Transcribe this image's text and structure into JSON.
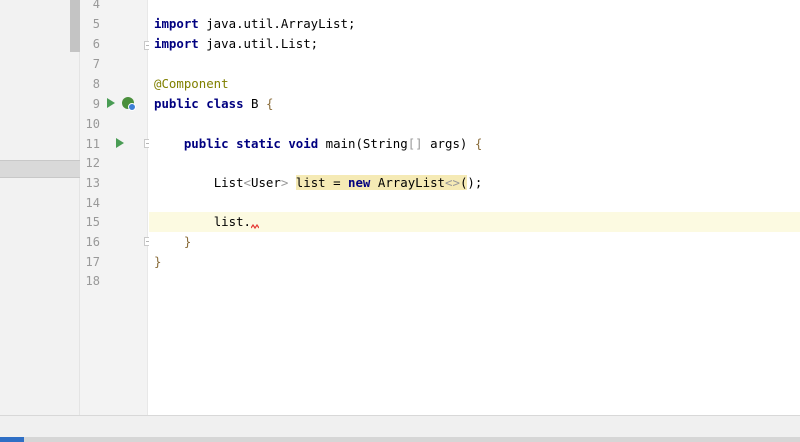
{
  "gutter": {
    "line_numbers": [
      "4",
      "5",
      "6",
      "7",
      "8",
      "9",
      "10",
      "11",
      "12",
      "13",
      "14",
      "15",
      "16",
      "17",
      "18"
    ]
  },
  "code": {
    "line5": {
      "kw": "import",
      "rest": " java.util.ArrayList;"
    },
    "line6": {
      "kw": "import",
      "rest": " java.util.List;"
    },
    "line8": {
      "annotation": "@Component"
    },
    "line9": {
      "kw1": "public",
      "kw2": "class",
      "name": " B ",
      "brace": "{"
    },
    "line11": {
      "indent": "    ",
      "kw1": "public",
      "kw2": "static",
      "kw3": "void",
      "method": " main(String",
      "brackets": "[]",
      "args": " args) ",
      "brace": "{"
    },
    "line13": {
      "indent": "        ",
      "type": "List",
      "lt": "<",
      "generic": "User",
      "gt": ">",
      "var": "list",
      "eq": " = ",
      "kw": "new",
      "ctor": " ArrayList",
      "diamond": "<>",
      "paren_open": "(",
      "paren_close": ")",
      "semi": ";"
    },
    "line15": {
      "indent": "        ",
      "text": "list."
    },
    "line16": {
      "indent": "    ",
      "brace": "}"
    },
    "line17": {
      "brace": "}"
    }
  },
  "icons": {
    "run": "run-icon",
    "bean": "spring-bean-icon",
    "fold": "fold-icon",
    "error": "error-squiggle-icon"
  },
  "colors": {
    "keyword": "#000080",
    "annotation": "#808000",
    "current_line": "#fcfae1",
    "highlight": "#f5eab5",
    "run_green": "#499c54",
    "error_red": "#e53935"
  }
}
